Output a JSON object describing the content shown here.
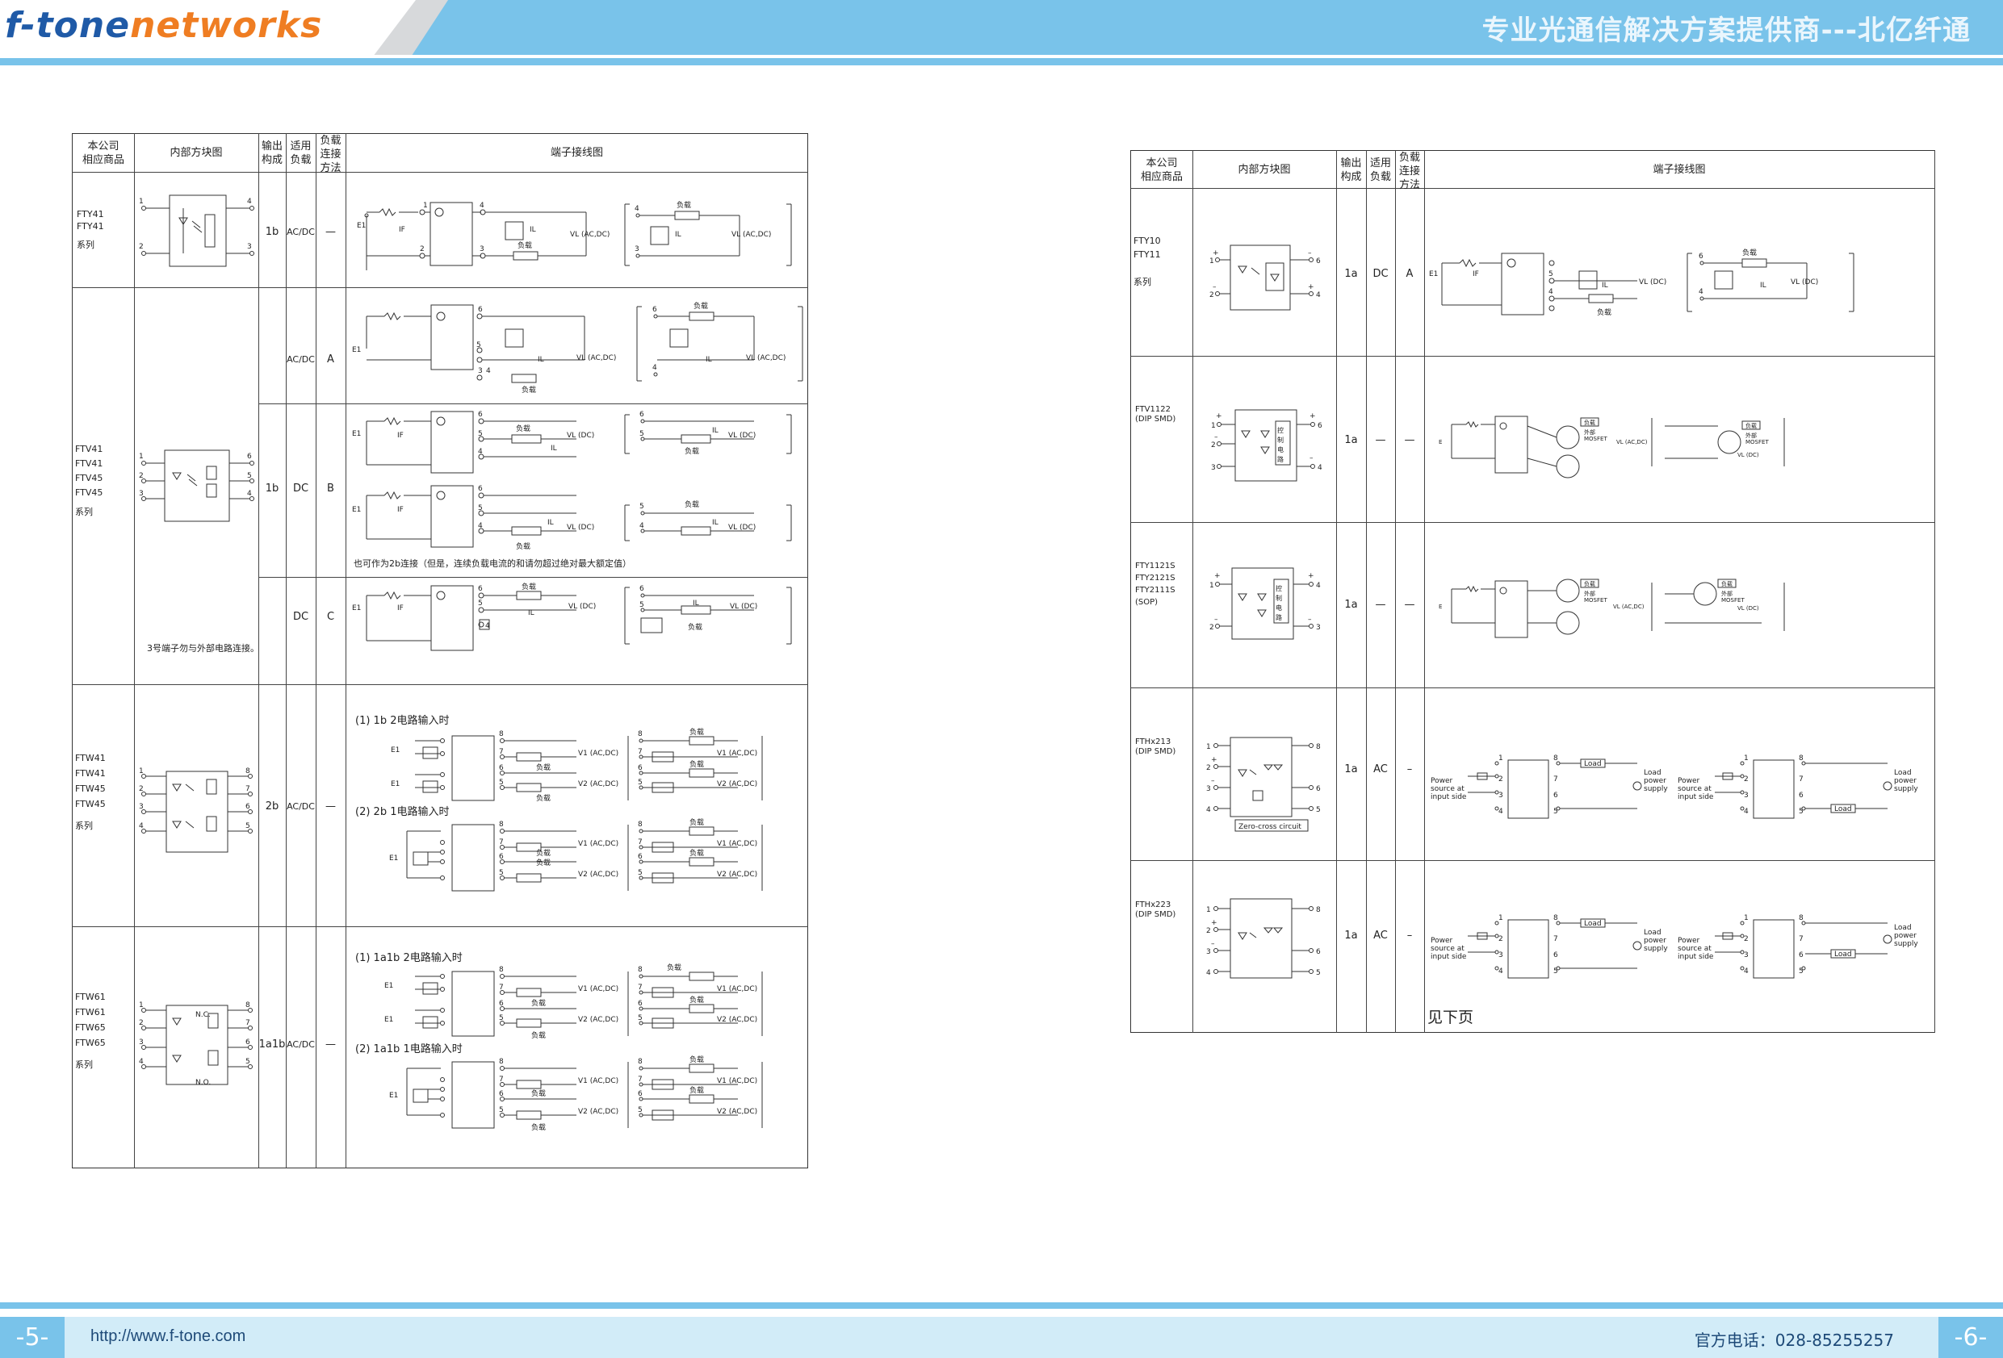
{
  "header": {
    "logo_part1": "f-tone",
    "logo_part2": "networks",
    "slogan": "专业光通信解决方案提供商---北亿纤通"
  },
  "footer": {
    "page_left": "-5-",
    "page_right": "-6-",
    "url": "http://www.f-tone.com",
    "phone": "官方电话：028-85255257"
  },
  "left_table": {
    "headers": {
      "product": "本公司\n相应商品",
      "block": "内部方块图",
      "output": "输出\n构成",
      "load": "适用\n负载",
      "method": "负载\n连接\n方法",
      "wiring": "端子接线图"
    },
    "rows": [
      {
        "products": [
          "FTY41",
          "FTY41",
          "系列"
        ],
        "output": "1b",
        "load": "AC/DC",
        "method": "—"
      },
      {
        "products": [
          "FTV41",
          "FTV41",
          "FTV45",
          "FTV45",
          "系列"
        ],
        "output": "1b",
        "sub": [
          {
            "load": "AC/DC",
            "method": "A"
          },
          {
            "load": "DC",
            "method": "B"
          },
          {
            "load": "DC",
            "method": "C"
          }
        ],
        "note_b": "也可作为2b连接（但是，连续负载电流的和请勿超过绝对最大额定值）",
        "note_block": "3号端子勿与外部电路连接。"
      },
      {
        "products": [
          "FTW41",
          "FTW41",
          "FTW45",
          "FTW45",
          "系列"
        ],
        "output": "2b",
        "load": "AC/DC",
        "method": "—",
        "title1": "(1) 1b 2电路输入时",
        "title2": "(2) 2b 1电路输入时"
      },
      {
        "products": [
          "FTW61",
          "FTW61",
          "FTW65",
          "FTW65",
          "系列"
        ],
        "output": "1a1b",
        "load": "AC/DC",
        "method": "—",
        "title1": "(1) 1a1b 2电路输入时",
        "title2": "(2) 1a1b 1电路输入时"
      }
    ]
  },
  "right_table": {
    "headers": {
      "product": "本公司\n相应商品",
      "block": "内部方块图",
      "output": "输出\n构成",
      "load": "适用\n负载",
      "method": "负载\n连接\n方法",
      "wiring": "端子接线图"
    },
    "rows": [
      {
        "products": [
          "FTY10",
          "FTY11",
          "",
          "系列"
        ],
        "output": "1a",
        "load": "DC",
        "method": "A"
      },
      {
        "products": [
          "FTV1122",
          "(DIP SMD)"
        ],
        "output": "1a",
        "load": "—",
        "method": "—",
        "block_label": "控制电路"
      },
      {
        "products": [
          "FTY1121S",
          "FTY2121S",
          "FTY2111S",
          "(SOP)"
        ],
        "output": "1a",
        "load": "—",
        "method": "—",
        "block_label": "控制电路"
      },
      {
        "products": [
          "FTHx213",
          "(DIP SMD)"
        ],
        "output": "1a",
        "load": "AC",
        "method": "–",
        "zero_cross": "Zero-cross circuit"
      },
      {
        "products": [
          "FTHx223",
          "(DIP SMD)"
        ],
        "output": "1a",
        "load": "AC",
        "method": "–"
      }
    ],
    "continued": "见下页"
  },
  "labels": {
    "load": "负载",
    "vl_acdc": "VL (AC,DC)",
    "vl_dc": "VL (DC)",
    "il": "IL",
    "if": "IF",
    "e1": "E1",
    "v1": "V1 (AC,DC)",
    "v2": "V2 (AC,DC)",
    "mosfet": "外部\nMOSFET",
    "power_src": "Power\nsource at\ninput side",
    "load_supply": "Load\npower\nsupply",
    "load_en": "Load",
    "nc": "N.C.",
    "no": "N.O."
  }
}
